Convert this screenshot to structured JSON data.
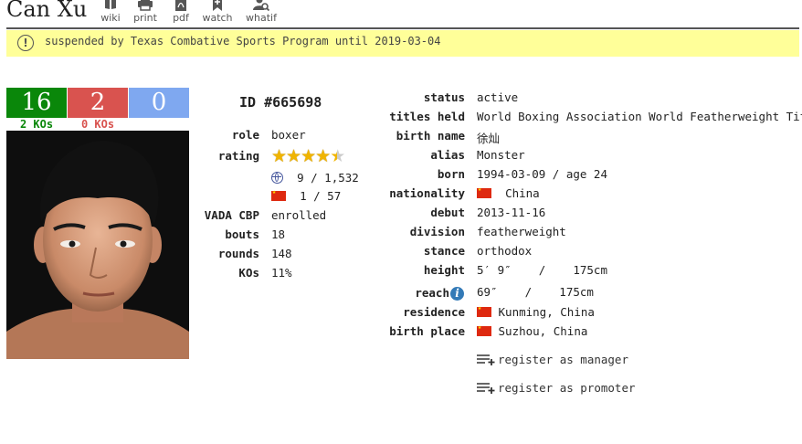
{
  "header": {
    "name": "Can Xu",
    "tools": [
      {
        "label": "wiki",
        "icon": "book-icon"
      },
      {
        "label": "print",
        "icon": "printer-icon"
      },
      {
        "label": "pdf",
        "icon": "pdf-icon"
      },
      {
        "label": "watch",
        "icon": "bookmark-plus-icon"
      },
      {
        "label": "whatif",
        "icon": "user-search-icon"
      }
    ]
  },
  "banner": {
    "text": "suspended by Texas Combative Sports Program until 2019-03-04",
    "icon": "exclamation-circle-icon"
  },
  "record": {
    "wins": "16",
    "losses": "2",
    "draws": "0",
    "wins_ko": "2 KOs",
    "losses_ko": "0 KOs",
    "colors": {
      "win": "#0a870a",
      "loss": "#d9534f",
      "draw": "#7fa8f0"
    }
  },
  "profile": {
    "id": "ID #665698",
    "role_label": "role",
    "role": "boxer",
    "rating_label": "rating",
    "rating_stars": 4.5,
    "world_rank": "9 / 1,532",
    "country_rank": "1 / 57",
    "vada_label": "VADA CBP",
    "vada": "enrolled",
    "bouts_label": "bouts",
    "bouts": "18",
    "rounds_label": "rounds",
    "rounds": "148",
    "kos_label": "KOs",
    "kos": "11%"
  },
  "details": {
    "status_label": "status",
    "status": "active",
    "titles_label": "titles held",
    "titles": "World Boxing Association World Featherweight Title",
    "birthname_label": "birth name",
    "birthname": "徐灿",
    "alias_label": "alias",
    "alias": "Monster",
    "born_label": "born",
    "born": "1994-03-09 / age 24",
    "nationality_label": "nationality",
    "nationality": "China",
    "debut_label": "debut",
    "debut": "2013-11-16",
    "division_label": "division",
    "division": "featherweight",
    "stance_label": "stance",
    "stance": "orthodox",
    "height_label": "height",
    "height": "5′ 9″    /    175cm",
    "reach_label": "reach",
    "reach": "69″    /    175cm",
    "residence_label": "residence",
    "residence": "Kunming, China",
    "birthplace_label": "birth place",
    "birthplace": "Suzhou, China"
  },
  "actions": {
    "manager": "register as manager",
    "promoter": "register as promoter"
  }
}
